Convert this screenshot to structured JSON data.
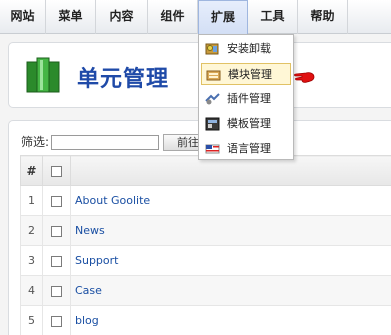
{
  "menubar": {
    "items": [
      "网站",
      "菜单",
      "内容",
      "组件",
      "扩展",
      "工具",
      "帮助"
    ]
  },
  "header": {
    "title": "单元管理"
  },
  "filter": {
    "label": "筛选:",
    "value": "",
    "button": "前往"
  },
  "table": {
    "headers": {
      "num": "#"
    },
    "rows": [
      {
        "num": "1",
        "name": "About Goolite"
      },
      {
        "num": "2",
        "name": "News"
      },
      {
        "num": "3",
        "name": "Support"
      },
      {
        "num": "4",
        "name": "Case"
      },
      {
        "num": "5",
        "name": "blog"
      }
    ]
  },
  "dropdown": {
    "items": [
      {
        "label": "安装卸载",
        "icon": "install-icon"
      },
      {
        "label": "模块管理",
        "icon": "module-icon"
      },
      {
        "label": "插件管理",
        "icon": "plugin-icon"
      },
      {
        "label": "模板管理",
        "icon": "template-icon"
      },
      {
        "label": "语言管理",
        "icon": "language-icon"
      }
    ],
    "highlighted_index": 1
  },
  "colors": {
    "title": "#1f4aa8",
    "link": "#1a4fa3",
    "pointer": "#e01010"
  }
}
